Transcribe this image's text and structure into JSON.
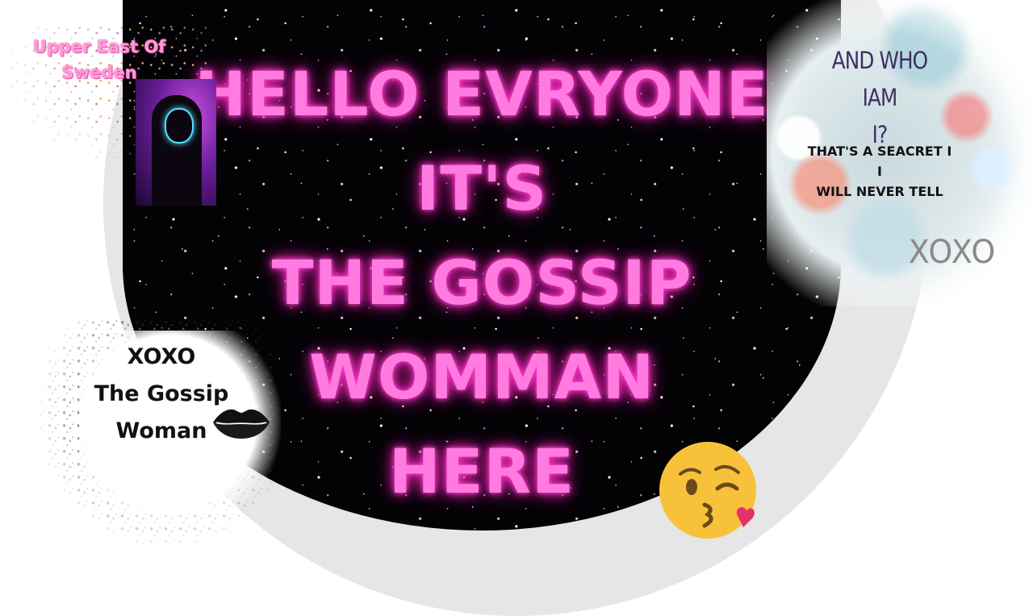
{
  "headline": {
    "lines": [
      "HELLO EVRYONE",
      "IT'S",
      "THE GOSSIP",
      "WOMMAN",
      "HERE"
    ],
    "color": "#ff7be0"
  },
  "upper_left": {
    "title_lines": [
      "Upper East Of",
      "Sweden"
    ],
    "color": "#ff9ad8"
  },
  "photo": {
    "icon": "masked-hooded-figure"
  },
  "right_panel": {
    "who_lines": [
      "AND WHO IAM",
      "I?"
    ],
    "secret_lines": [
      "THAT'S A SEACRET I",
      "I",
      "WILL NEVER TELL"
    ],
    "xoxo": "XOXO",
    "who_color": "#3f2e64"
  },
  "signoff": {
    "lines": [
      "XOXO",
      "The Gossip",
      "Woman"
    ],
    "lips_icon": "lips-icon"
  },
  "emoji": {
    "icon": "kissing-face-wink-emoji"
  }
}
